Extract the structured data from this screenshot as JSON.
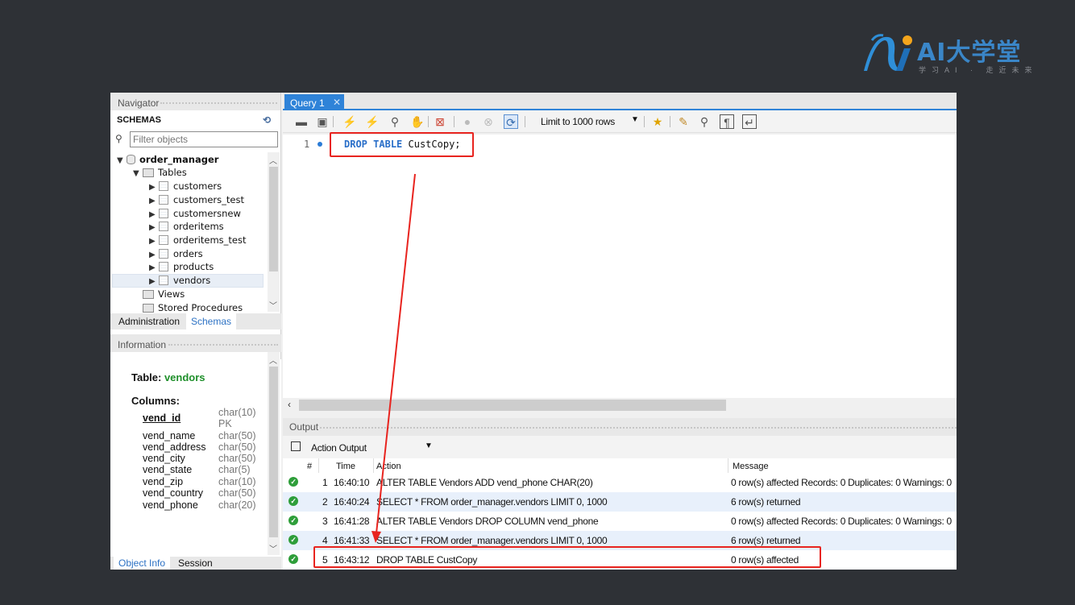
{
  "logo": {
    "text": "AI大学堂",
    "subtitle": "学习AI · 走近未来"
  },
  "navigator": {
    "header": "Navigator",
    "schemas_label": "SCHEMAS",
    "filter_placeholder": "Filter objects",
    "schema": "order_manager",
    "tables_label": "Tables",
    "tables": [
      "customers",
      "customers_test",
      "customersnew",
      "orderitems",
      "orderitems_test",
      "orders",
      "products",
      "vendors"
    ],
    "views_label": "Views",
    "procs_label": "Stored Procedures",
    "tab_admin": "Administration",
    "tab_schemas": "Schemas"
  },
  "information": {
    "header": "Information",
    "table_prefix": "Table:",
    "table_name": "vendors",
    "columns_label": "Columns:",
    "columns": [
      {
        "name": "vend_id",
        "type": "char(10)",
        "extra": "PK"
      },
      {
        "name": "vend_name",
        "type": "char(50)"
      },
      {
        "name": "vend_address",
        "type": "char(50)"
      },
      {
        "name": "vend_city",
        "type": "char(50)"
      },
      {
        "name": "vend_state",
        "type": "char(5)"
      },
      {
        "name": "vend_zip",
        "type": "char(10)"
      },
      {
        "name": "vend_country",
        "type": "char(50)"
      },
      {
        "name": "vend_phone",
        "type": "char(20)"
      }
    ],
    "tab_objinfo": "Object Info",
    "tab_session": "Session"
  },
  "query": {
    "tab_label": "Query 1",
    "limit_label": "Limit to 1000 rows",
    "line_number": "1",
    "sql_kw1": "DROP",
    "sql_kw2": "TABLE",
    "sql_rest": "CustCopy;"
  },
  "output": {
    "header": "Output",
    "selector": "Action Output",
    "columns": {
      "num": "#",
      "time": "Time",
      "action": "Action",
      "message": "Message"
    },
    "rows": [
      {
        "num": "1",
        "time": "16:40:10",
        "action": "ALTER TABLE Vendors  ADD vend_phone CHAR(20)",
        "message": "0 row(s) affected Records: 0  Duplicates: 0  Warnings: 0"
      },
      {
        "num": "2",
        "time": "16:40:24",
        "action": "SELECT * FROM order_manager.vendors LIMIT 0, 1000",
        "message": "6 row(s) returned"
      },
      {
        "num": "3",
        "time": "16:41:28",
        "action": "ALTER TABLE Vendors  DROP COLUMN vend_phone",
        "message": "0 row(s) affected Records: 0  Duplicates: 0  Warnings: 0"
      },
      {
        "num": "4",
        "time": "16:41:33",
        "action": "SELECT * FROM order_manager.vendors LIMIT 0, 1000",
        "message": "6 row(s) returned"
      },
      {
        "num": "5",
        "time": "16:43:12",
        "action": "DROP TABLE CustCopy",
        "message": "0 row(s) affected"
      }
    ]
  },
  "colors": {
    "accent": "#2f83d8",
    "annotation": "#e8241f",
    "ok": "#2e9e3a",
    "table_name": "#1e8f2a"
  }
}
